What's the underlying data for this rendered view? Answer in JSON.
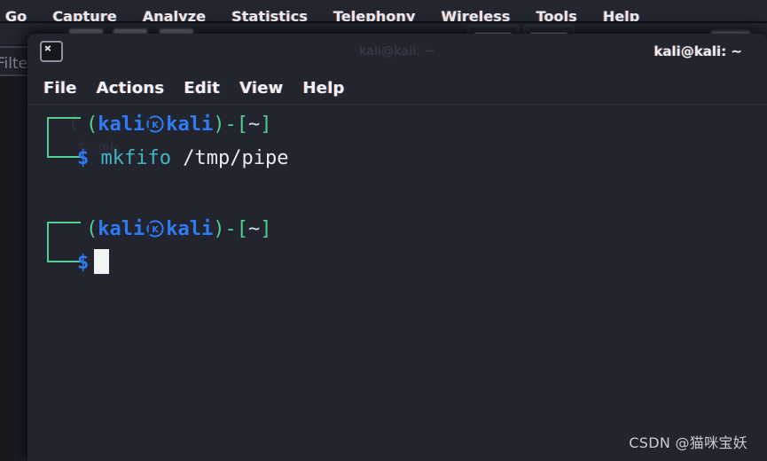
{
  "background_app": {
    "name": "wireshark",
    "menubar": [
      {
        "label": "Go",
        "mnemonic": "G"
      },
      {
        "label": "Capture",
        "mnemonic": "C"
      },
      {
        "label": "Analyze",
        "mnemonic": "A"
      },
      {
        "label": "Statistics",
        "mnemonic": "S"
      },
      {
        "label": "Telephony",
        "mnemonic": "y"
      },
      {
        "label": "Wireless",
        "mnemonic": "W"
      },
      {
        "label": "Tools",
        "mnemonic": "T"
      },
      {
        "label": "Help",
        "mnemonic": "H"
      }
    ],
    "filter_bar_text": "Filte",
    "colors": {
      "menubar_bg": "#23262f",
      "body_bg": "#1b1e26",
      "filter_bg": "#20232b"
    }
  },
  "terminal": {
    "icon": "terminal-icon",
    "title_center": "kali@kali: ~",
    "title_right": "kali@kali: ~",
    "menubar": [
      {
        "label": "File"
      },
      {
        "label": "Actions"
      },
      {
        "label": "Edit"
      },
      {
        "label": "View"
      },
      {
        "label": "Help"
      }
    ],
    "colors": {
      "background": "#22252e",
      "prompt_decoration": "#4fcf92",
      "prompt_user": "#2f7bf6",
      "command": "#41b6c4",
      "argument": "#e8eaef",
      "cursor": "#f2f3f5"
    },
    "prompts": [
      {
        "open_paren": "(",
        "user": "kali",
        "logo": "kali-dragon-logo",
        "host": "kali",
        "close_paren": ")",
        "dash": "-",
        "bracket_open": "[",
        "cwd": "~",
        "bracket_close": "]",
        "sigil": "$",
        "command": "mkfifo",
        "argument": "/tmp/pipe"
      },
      {
        "open_paren": "(",
        "user": "kali",
        "logo": "kali-dragon-logo",
        "host": "kali",
        "close_paren": ")",
        "dash": "-",
        "bracket_open": "[",
        "cwd": "~",
        "bracket_close": "]",
        "sigil": "$",
        "command": "",
        "argument": ""
      }
    ],
    "ghost_text_1": "(",
    "ghost_text_2": "$ mk"
  },
  "watermark": "CSDN @猫咪宝妖"
}
